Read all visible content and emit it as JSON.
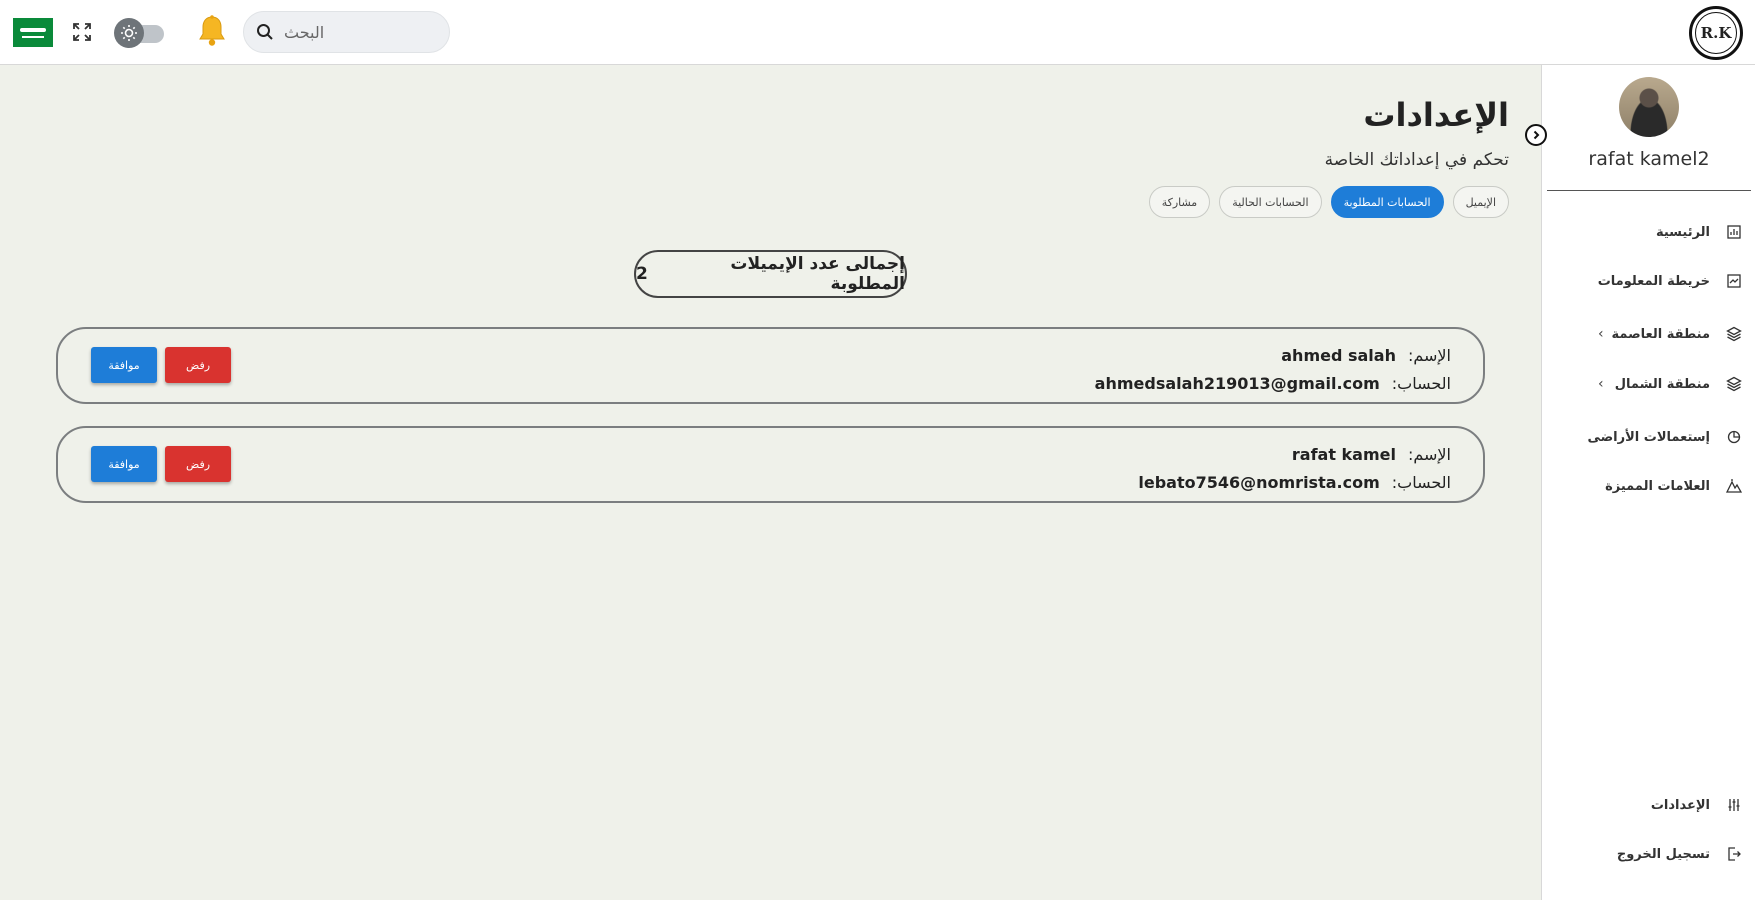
{
  "header": {
    "search_placeholder": "البحث",
    "logo_text": "R.K",
    "flag_icon": "saudi-flag-icon",
    "fullscreen_icon": "fullscreen-icon",
    "theme_toggle_icon": "sun-icon",
    "notification_icon": "bell-icon"
  },
  "sidebar": {
    "username": "rafat kamel2",
    "items": [
      {
        "label": "الرئيسية",
        "icon": "chart-icon",
        "has_chevron": false
      },
      {
        "label": "خريطة المعلومات",
        "icon": "map-icon",
        "has_chevron": false
      },
      {
        "label": "منطقة العاصمة",
        "icon": "layers-icon",
        "has_chevron": true
      },
      {
        "label": "منطقة الشمال",
        "icon": "layers-icon",
        "has_chevron": true
      },
      {
        "label": "إستعمالات الأراضى",
        "icon": "pie-icon",
        "has_chevron": false
      },
      {
        "label": "العلامات المميزة",
        "icon": "landmark-icon",
        "has_chevron": false
      }
    ],
    "bottom_items": [
      {
        "label": "الإعدادات",
        "icon": "sliders-icon"
      },
      {
        "label": "تسجيل الخروج",
        "icon": "logout-icon"
      }
    ]
  },
  "main": {
    "title": "الإعدادات",
    "subtitle": "تحكم في إعداداتك الخاصة",
    "tabs": [
      {
        "label": "الإيميل",
        "active": false
      },
      {
        "label": "الحسابات المطلوبة",
        "active": true
      },
      {
        "label": "الحسابات الحالية",
        "active": false
      },
      {
        "label": "مشاركة",
        "active": false
      }
    ],
    "total_label": "إجمالى عدد الإيميلات المطلوبة",
    "total_count": "2",
    "name_key": "الإسم:",
    "account_key": "الحساب:",
    "approve_label": "موافقة",
    "reject_label": "رفض",
    "requests": [
      {
        "name": "ahmed salah",
        "email": "ahmedsalah219013@gmail.com"
      },
      {
        "name": "rafat kamel",
        "email": "lebato7546@nomrista.com"
      }
    ]
  },
  "colors": {
    "accent": "#1e7dd8",
    "danger": "#d9332f",
    "background": "#eff1ea"
  }
}
